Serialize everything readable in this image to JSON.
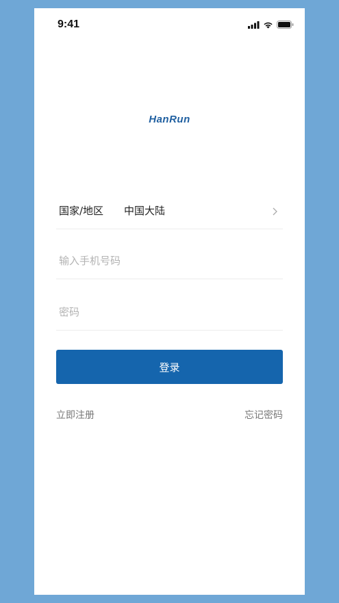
{
  "status_bar": {
    "time": "9:41",
    "icons": [
      "cellular-signal-icon",
      "wifi-icon",
      "battery-icon"
    ]
  },
  "logo": {
    "text": "HanRun",
    "color": "#1f5fa0"
  },
  "form": {
    "country_label": "国家/地区",
    "country_value": "中国大陆",
    "phone_placeholder": "输入手机号码",
    "password_placeholder": "密码"
  },
  "actions": {
    "login_label": "登录",
    "register_label": "立即注册",
    "forgot_label": "忘记密码"
  },
  "colors": {
    "background": "#6fa7d6",
    "primary_button": "#1565ad",
    "logo": "#1f5fa0"
  }
}
